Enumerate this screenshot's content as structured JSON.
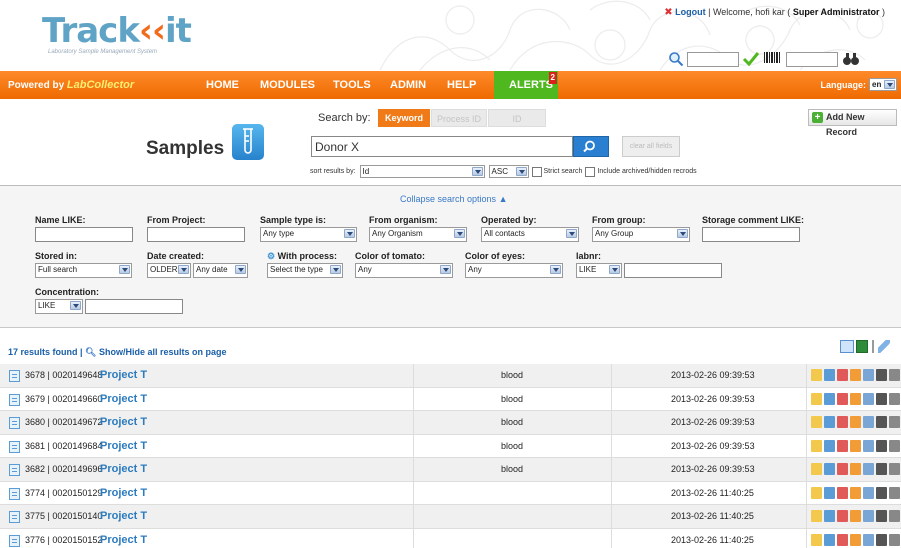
{
  "app": {
    "name": "Track",
    "name_suffix": "it",
    "tagline": "Laboratory Sample Management System"
  },
  "header": {
    "logout": "Logout",
    "welcome": " | Welcome, hofi kar ( ",
    "role": "Super Administrator",
    "close_paren": " )"
  },
  "nav": {
    "powered_by": "Powered by ",
    "powered_brand": "LabCollector",
    "items": [
      "HOME",
      "MODULES",
      "TOOLS",
      "ADMIN",
      "HELP"
    ],
    "alerts_label": "ALERTS",
    "alerts_count": "2",
    "language_label": "Language:",
    "language_value": "en"
  },
  "search": {
    "page_title": "Samples",
    "search_by_label": "Search by:",
    "tabs": [
      "Keyword",
      "Process ID",
      "ID"
    ],
    "query": "Donor X",
    "clear_label": "clear all fields",
    "sort_label": "sort results by:",
    "sort_field": "Id",
    "sort_order": "ASC",
    "strict_label": "Strict search",
    "archived_label": "Include archived/hidden recrods",
    "add_record": "Add New Record"
  },
  "filters": {
    "collapse_label": "Collapse search options",
    "name_like": "Name LIKE:",
    "from_project": "From Project:",
    "sample_type": "Sample type is:",
    "sample_type_value": "Any type",
    "from_organism": "From organism:",
    "organism_value": "Any Organism",
    "operated_by": "Operated by:",
    "operated_value": "All contacts",
    "from_group": "From group:",
    "group_value": "Any Group",
    "storage_comment": "Storage comment LIKE:",
    "stored_in": "Stored in:",
    "stored_value": "Full search",
    "date_created": "Date created:",
    "date_op": "OLDER",
    "date_value": "Any date",
    "with_process": "With process:",
    "process_value": "Select the type",
    "color_tomato": "Color of tomato:",
    "tomato_value": "Any",
    "color_eyes": "Color of eyes:",
    "eyes_value": "Any",
    "labnr": "labnr:",
    "labnr_op": "LIKE",
    "concentration": "Concentration:",
    "concentration_op": "LIKE"
  },
  "results": {
    "summary": "17 results found | ",
    "show_hide": "Show/Hide all results on page",
    "rows": [
      {
        "id": "3678 | 0020149648",
        "project": "Project T",
        "type": "blood",
        "date": "2013-02-26 09:39:53"
      },
      {
        "id": "3679 | 0020149660",
        "project": "Project T",
        "type": "blood",
        "date": "2013-02-26 09:39:53"
      },
      {
        "id": "3680 | 0020149672",
        "project": "Project T",
        "type": "blood",
        "date": "2013-02-26 09:39:53"
      },
      {
        "id": "3681 | 0020149684",
        "project": "Project T",
        "type": "blood",
        "date": "2013-02-26 09:39:53"
      },
      {
        "id": "3682 | 0020149696",
        "project": "Project T",
        "type": "blood",
        "date": "2013-02-26 09:39:53"
      },
      {
        "id": "3774 | 0020150129",
        "project": "Project T",
        "type": "",
        "date": "2013-02-26 11:40:25"
      },
      {
        "id": "3775 | 0020150140",
        "project": "Project T",
        "type": "",
        "date": "2013-02-26 11:40:25"
      },
      {
        "id": "3776 | 0020150152",
        "project": "Project T",
        "type": "",
        "date": "2013-02-26 11:40:25"
      }
    ]
  },
  "colors": {
    "nav_orange": "#f27a1a",
    "alerts_green": "#4fb81f",
    "link_blue": "#2b7bbf",
    "logo_blue": "#5fa3c6"
  }
}
